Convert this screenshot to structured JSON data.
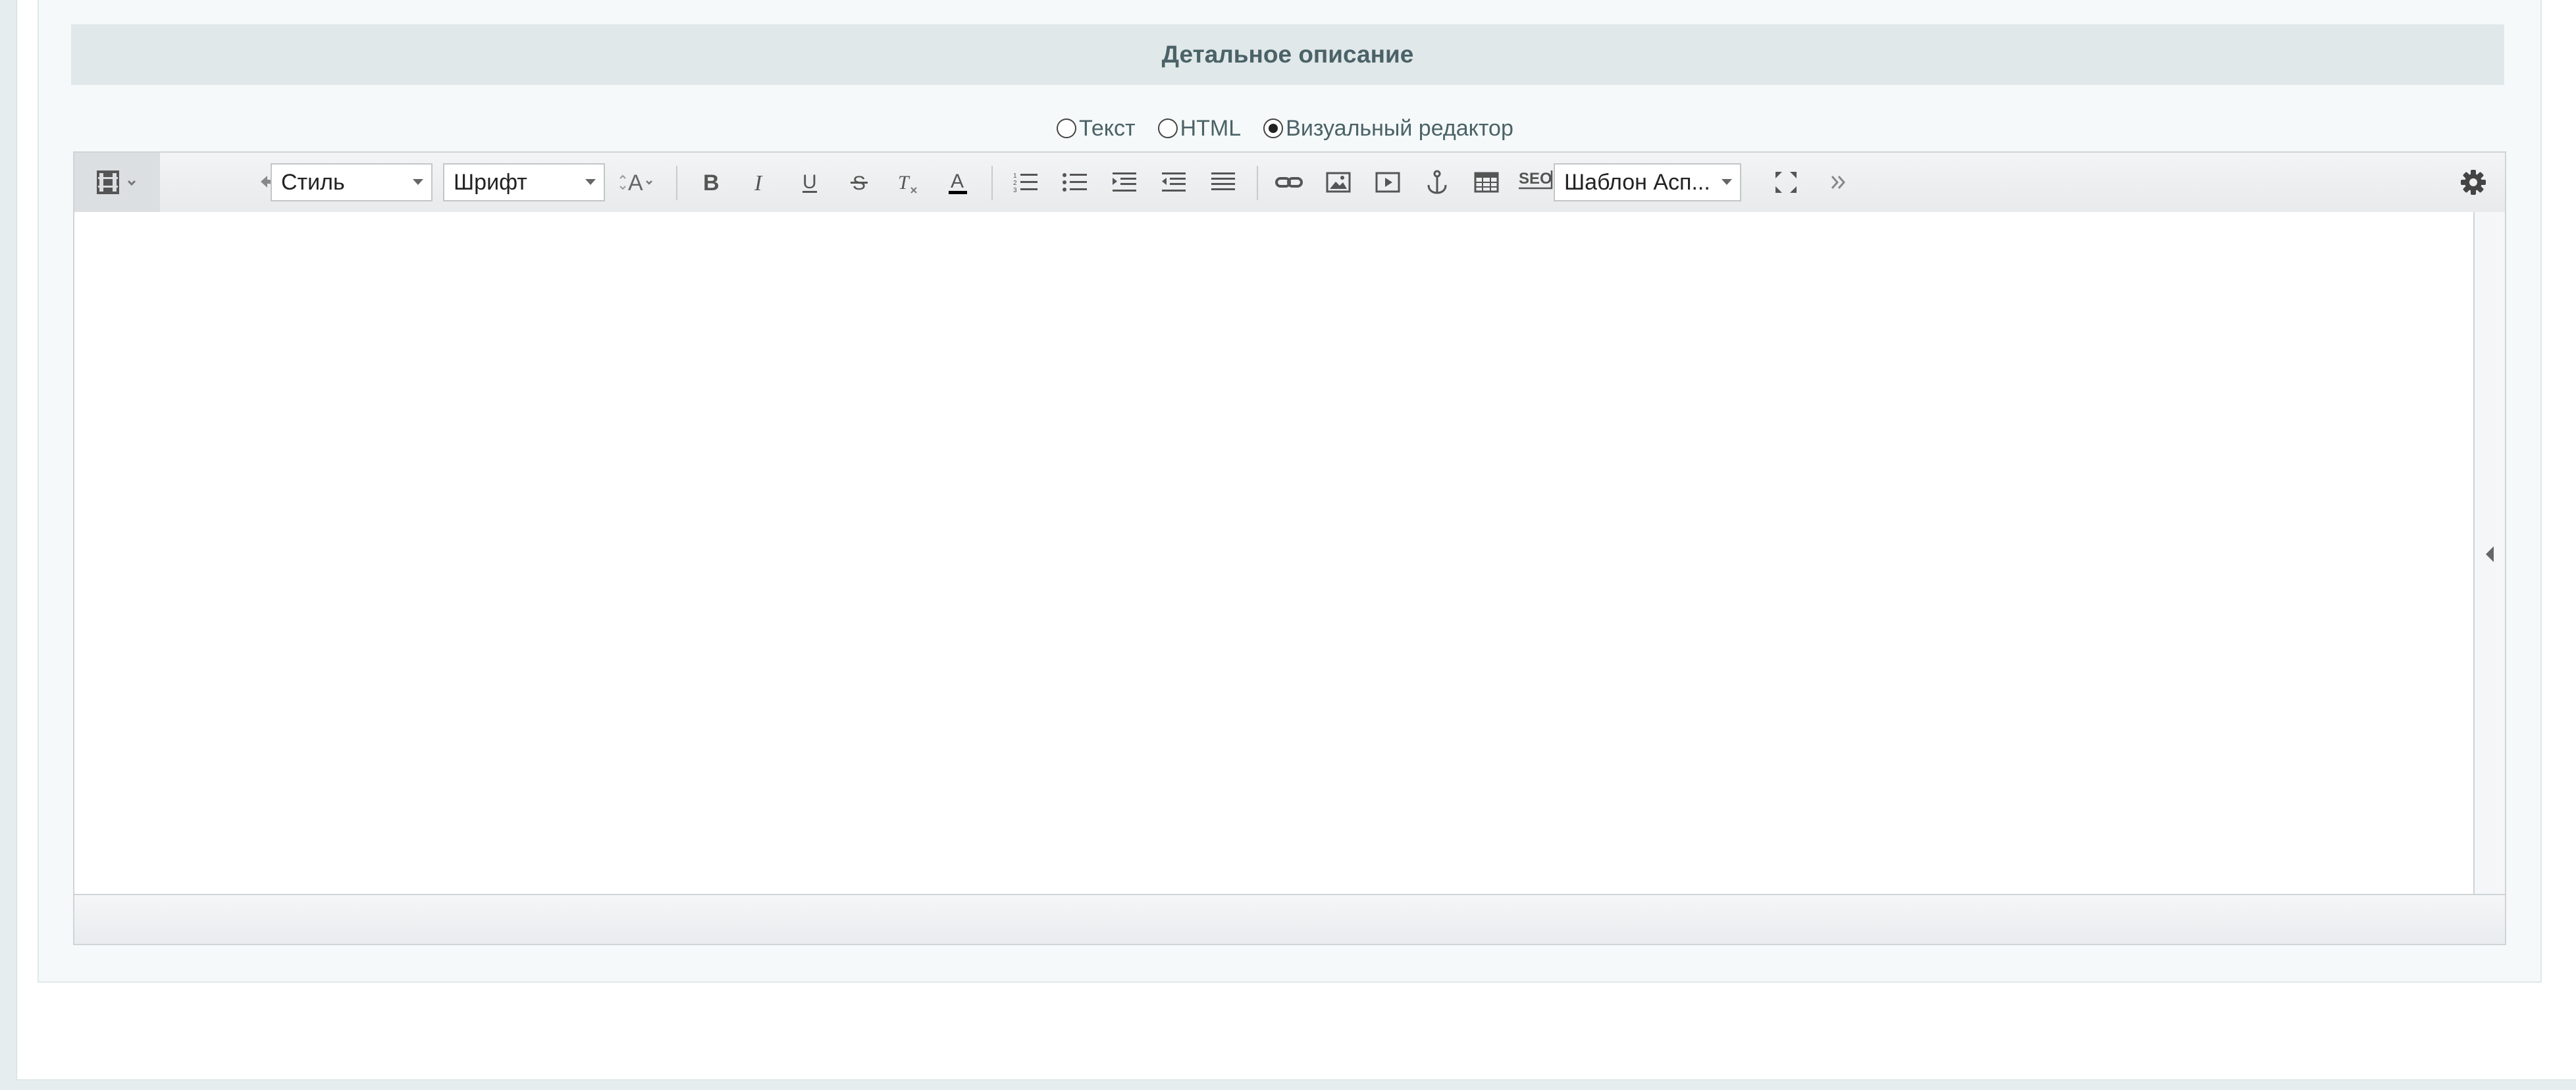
{
  "section": {
    "title": "Детальное описание"
  },
  "editor_modes": {
    "options": [
      "Текст",
      "HTML",
      "Визуальный редактор"
    ],
    "selected": "Визуальный редактор"
  },
  "toolbar": {
    "style_select": "Стиль",
    "font_select": "Шрифт",
    "template_select": "Шаблон Асп...",
    "seo_label": "SEO"
  }
}
